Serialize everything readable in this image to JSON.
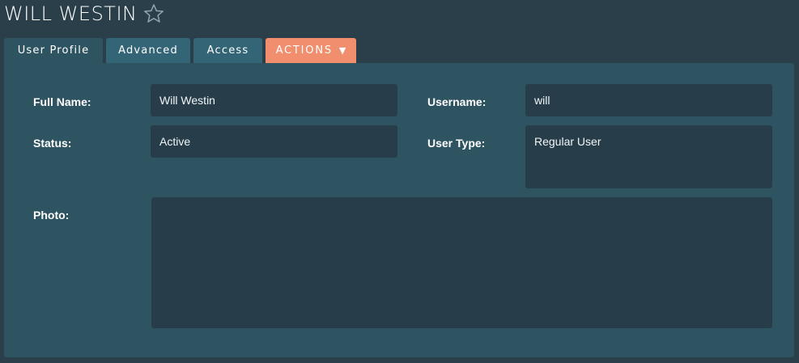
{
  "header": {
    "title": "WILL WESTIN",
    "favorite_icon": "star-outline-icon"
  },
  "tabs": [
    {
      "label": "User Profile",
      "active": true
    },
    {
      "label": "Advanced",
      "active": false
    },
    {
      "label": "Access",
      "active": false
    },
    {
      "label": "ACTIONS",
      "active": false,
      "caret": "▼"
    }
  ],
  "form": {
    "full_name": {
      "label": "Full Name:",
      "value": "Will Westin"
    },
    "username": {
      "label": "Username:",
      "value": "will"
    },
    "status": {
      "label": "Status:",
      "value": "Active"
    },
    "user_type": {
      "label": "User Type:",
      "value": "Regular User"
    },
    "photo": {
      "label": "Photo:",
      "value": ""
    }
  },
  "colors": {
    "background": "#2a3f4a",
    "panel": "#2e5461",
    "tab": "#336576",
    "actions_accent": "#f08e6e",
    "field": "#273e4a"
  }
}
